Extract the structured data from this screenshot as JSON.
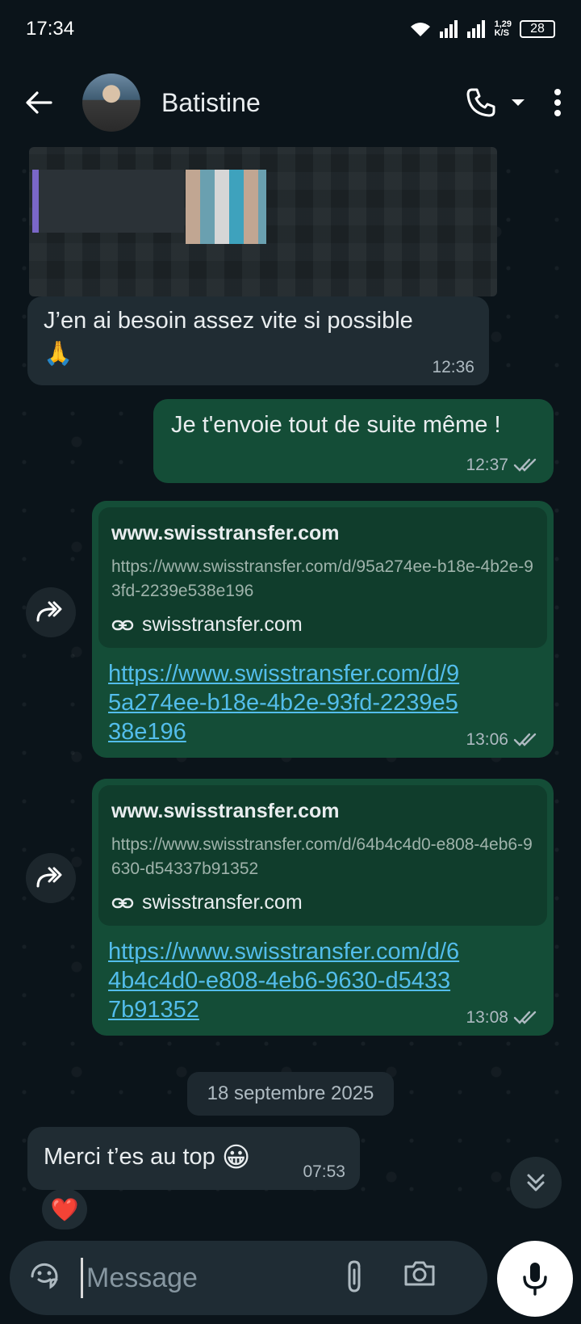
{
  "status_bar": {
    "time": "17:34",
    "net_speed_value": "1,29",
    "net_speed_unit": "K/S",
    "battery": "28"
  },
  "header": {
    "contact_name": "Batistine"
  },
  "messages": [
    {
      "text": "J’en ai besoin assez vite si possible",
      "emoji": "🙏",
      "time": "12:36"
    },
    {
      "text": "Je t'envoie tout de suite même !",
      "time": "12:37"
    },
    {
      "card_title": "www.swisstransfer.com",
      "card_url": "https://www.swisstransfer.com/d/95a274ee-b18e-4b2e-93fd-2239e538e196",
      "card_domain": "swisstransfer.com",
      "link": "https://www.swisstransfer.com/d/95a274ee-b18e-4b2e-93fd-2239e538e196",
      "time": "13:06"
    },
    {
      "card_title": "www.swisstransfer.com",
      "card_url": "https://www.swisstransfer.com/d/64b4c4d0-e808-4eb6-9630-d54337b91352",
      "card_domain": "swisstransfer.com",
      "link": "https://www.swisstransfer.com/d/64b4c4d0-e808-4eb6-9630-d54337b91352",
      "time": "13:08"
    },
    {
      "text": "Merci t’es au top",
      "emoji": "😀",
      "time": "07:53",
      "reaction": "❤️"
    }
  ],
  "date_separator": "18 septembre 2025",
  "composer": {
    "placeholder": "Message"
  },
  "icons": [
    "back-arrow-icon",
    "phone-icon",
    "dropdown-icon",
    "more-vert-icon",
    "forward-icon",
    "link-icon",
    "double-check-icon",
    "sticker-icon",
    "attach-icon",
    "camera-icon",
    "mic-icon",
    "scroll-down-icon"
  ],
  "colors": {
    "background": "#0b141a",
    "incoming": "#202c33",
    "outgoing": "#144d37",
    "link": "#53bdeb"
  }
}
